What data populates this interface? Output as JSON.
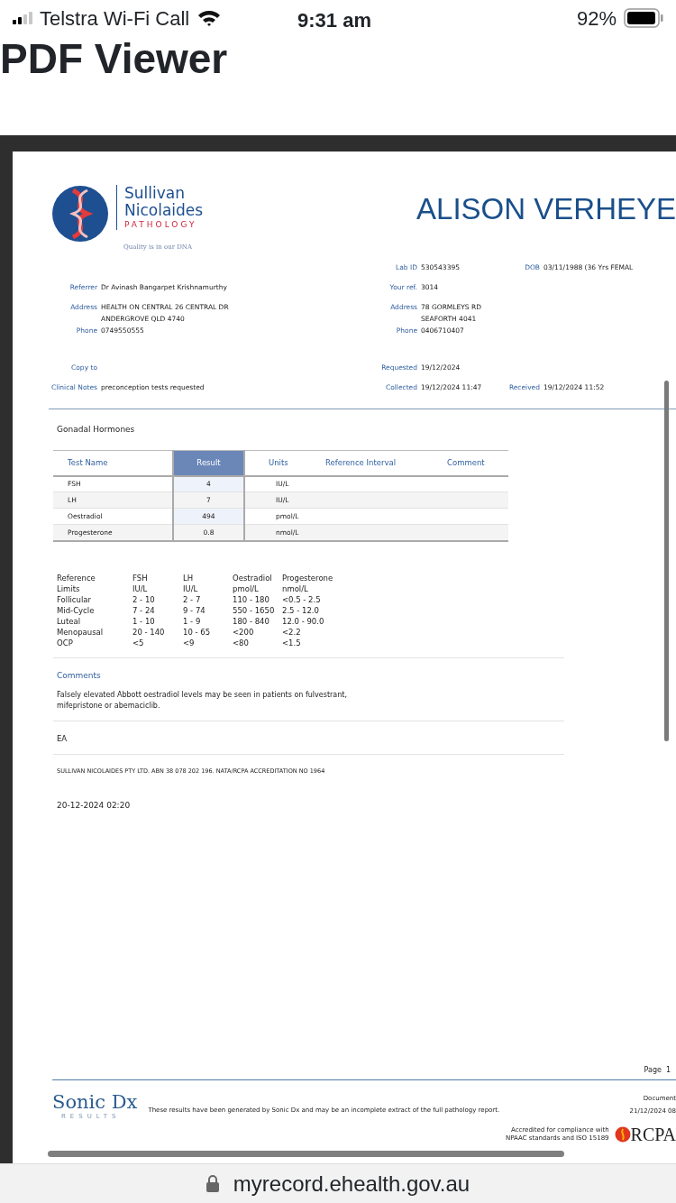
{
  "status_bar": {
    "carrier": "Telstra Wi-Fi Call",
    "time": "9:31 am",
    "battery": "92%"
  },
  "title": "PDF Viewer",
  "document": {
    "lab_logo": {
      "line_1": "Sullivan",
      "line_2": "Nicolaides",
      "line_3": "PATHOLOGY",
      "tagline": "Quality is in our DNA"
    },
    "patient_name": "ALISON VERHEYE",
    "details": [
      {
        "middle": {
          "label": "Lab ID",
          "value": [
            "530543395"
          ]
        },
        "right": {
          "label": "DOB",
          "value": [
            "03/11/1988 (36 Yrs FEMAL"
          ]
        }
      },
      {
        "left": {
          "label": "Referrer",
          "value": [
            "Dr Avinash Bangarpet Krishnamurthy"
          ]
        },
        "middle": {
          "label": "Your ref.",
          "value": [
            "3014"
          ]
        }
      },
      {
        "left": {
          "label": "Address",
          "value": [
            "HEALTH ON CENTRAL 26 CENTRAL DR",
            "ANDERGROVE QLD 4740"
          ]
        },
        "middle": {
          "label": "Address",
          "value": [
            "78 GORMLEYS RD",
            "SEAFORTH 4041"
          ]
        }
      },
      {
        "left": {
          "label": "Phone",
          "value": [
            "0749550555"
          ]
        },
        "middle": {
          "label": "Phone",
          "value": [
            "0406710407"
          ]
        }
      },
      {
        "left": {
          "label": "Copy to"
        },
        "middle": {
          "label": "Requested",
          "value": [
            "19/12/2024"
          ]
        }
      },
      {
        "left": {
          "label": "Clinical Notes",
          "value": [
            "preconception tests requested"
          ]
        },
        "middle": {
          "label": "Collected",
          "value": [
            "19/12/2024 11:47"
          ]
        },
        "right": {
          "label": "Received",
          "value": [
            "19/12/2024 11:52"
          ]
        }
      }
    ],
    "section_title": "Gonadal Hormones",
    "results_table": {
      "columns": [
        "Test Name",
        "Result",
        "Units",
        "Reference Interval",
        "Comment"
      ],
      "rows": [
        {
          "test": "FSH",
          "result": "4",
          "units": "IU/L"
        },
        {
          "test": "LH",
          "result": "7",
          "units": "IU/L"
        },
        {
          "test": "Oestradiol",
          "result": "494",
          "units": "pmol/L"
        },
        {
          "test": "Progesterone",
          "result": "0.8",
          "units": "nmol/L"
        }
      ]
    },
    "reference_limits": [
      [
        "Reference",
        "FSH",
        "LH",
        "Oestradiol",
        "Progesterone"
      ],
      [
        "Limits",
        "IU/L",
        "IU/L",
        "pmol/L",
        "nmol/L"
      ],
      [
        "Follicular",
        "2 - 10",
        "2 - 7",
        "110 - 180",
        "<0.5 - 2.5"
      ],
      [
        "Mid-Cycle",
        "7 - 24",
        "9 - 74",
        "550 - 1650",
        "2.5 - 12.0"
      ],
      [
        "Luteal",
        "1 - 10",
        "1 - 9",
        "180 - 840",
        "12.0 - 90.0"
      ],
      [
        "Menopausal",
        "20 - 140",
        "10 - 65",
        "<200",
        "<2.2"
      ],
      [
        "OCP",
        "<5",
        "<9",
        "<80",
        "<1.5"
      ]
    ],
    "comments_heading": "Comments",
    "comment": "Falsely elevated Abbott oestradiol levels may be seen in patients on fulvestrant, mifepristone or abemaciclib.",
    "initials": "EA",
    "company_line": "SULLIVAN NICOLAIDES PTY LTD. ABN 38 078 202 196. NATA/RCPA ACCREDITATION NO 1964",
    "printed_at": "20-12-2024 02:20",
    "page_label": "Page",
    "page_number": "1",
    "footer": {
      "logo_name": "Sonic Dx",
      "logo_sub": "RESULTS",
      "disclaimer": "These results have been generated by Sonic Dx and may be an incomplete extract of the full pathology report.",
      "document_label": "Document",
      "document_date": "21/12/2024 08",
      "accreditation": [
        "Accredited for compliance with",
        "NPAAC standards and ISO 15189"
      ],
      "accreditor_logo": "RCPA"
    }
  },
  "address_bar": {
    "url": "myrecord.ehealth.gov.au"
  }
}
